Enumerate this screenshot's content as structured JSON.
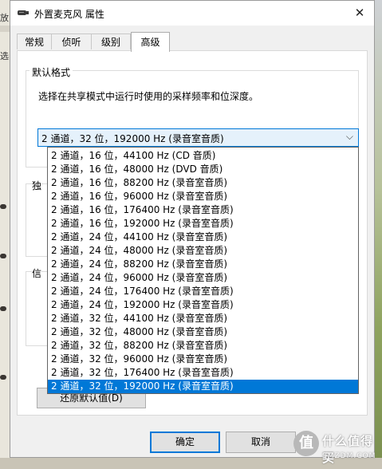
{
  "window": {
    "title": "外置麦克风 属性",
    "close_glyph": "✕"
  },
  "background_peek": {
    "top_fragment": "放",
    "mid_fragment": "选"
  },
  "tabs": [
    {
      "label": "常规"
    },
    {
      "label": "侦听"
    },
    {
      "label": "级别"
    },
    {
      "label": "高级"
    }
  ],
  "default_format": {
    "group_title": "默认格式",
    "description": "选择在共享模式中运行时使用的采样频率和位深度。",
    "selected_value": "2 通道，32 位，192000 Hz (录音室音质)",
    "options": [
      "2 通道，16 位，44100 Hz (CD 音质)",
      "2 通道，16 位，48000 Hz (DVD 音质)",
      "2 通道，16 位，88200 Hz (录音室音质)",
      "2 通道，16 位，96000 Hz (录音室音质)",
      "2 通道，16 位，176400 Hz (录音室音质)",
      "2 通道，16 位，192000 Hz (录音室音质)",
      "2 通道，24 位，44100 Hz (录音室音质)",
      "2 通道，24 位，48000 Hz (录音室音质)",
      "2 通道，24 位，88200 Hz (录音室音质)",
      "2 通道，24 位，96000 Hz (录音室音质)",
      "2 通道，24 位，176400 Hz (录音室音质)",
      "2 通道，24 位，192000 Hz (录音室音质)",
      "2 通道，32 位，44100 Hz (录音室音质)",
      "2 通道，32 位，48000 Hz (录音室音质)",
      "2 通道，32 位，88200 Hz (录音室音质)",
      "2 通道，32 位，96000 Hz (录音室音质)",
      "2 通道，32 位，176400 Hz (录音室音质)",
      "2 通道，32 位，192000 Hz (录音室音质)"
    ],
    "highlighted_option": "2 通道，32 位，192000 Hz (录音室音质)"
  },
  "hidden_groups": {
    "exclusive_fragment": "独",
    "signal_fragment": "信"
  },
  "restore_button": {
    "label": "还原默认值(D)"
  },
  "footer": {
    "ok_label": "确定",
    "cancel_label": "取消"
  },
  "watermark": {
    "logo_glyph": "值",
    "text": "什么值得买",
    "subtext": "SMZDM.COM"
  },
  "colors": {
    "accent": "#0078d7",
    "combo_bg": "#e5f1fb",
    "window_bg": "#f0f0f0"
  }
}
